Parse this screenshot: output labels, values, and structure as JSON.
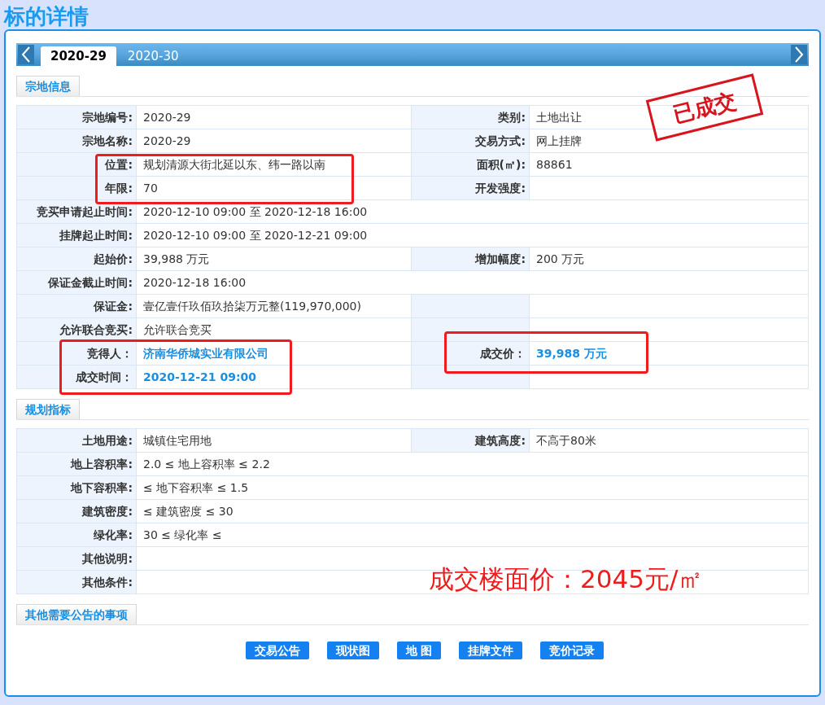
{
  "title": "标的详情",
  "tabs": [
    {
      "label": "2020-29",
      "selected": true
    },
    {
      "label": "2020-30",
      "selected": false
    }
  ],
  "stamp": "已成交",
  "annotation": "成交楼面价：2045元/㎡",
  "sections": [
    {
      "title": "宗地信息",
      "rows": [
        {
          "kind": "pair",
          "label": "宗地编号:",
          "value": "2020-29",
          "label2": "类别:",
          "value2": "土地出让"
        },
        {
          "kind": "pair",
          "label": "宗地名称:",
          "value": "2020-29",
          "label2": "交易方式:",
          "value2": "网上挂牌"
        },
        {
          "kind": "pair",
          "label": "位置:",
          "value": "规划清源大街北延以东、纬一路以南",
          "label2": "面积(㎡):",
          "value2": "88861"
        },
        {
          "kind": "pair",
          "label": "年限:",
          "value": "70",
          "label2": "开发强度:"
        },
        {
          "kind": "wide",
          "label": "竞买申请起止时间:",
          "value": "2020-12-10 09:00 至 2020-12-18 16:00"
        },
        {
          "kind": "wide",
          "label": "挂牌起止时间:",
          "value": "2020-12-10 09:00 至 2020-12-21 09:00"
        },
        {
          "kind": "pair",
          "label": "起始价:",
          "value": "39,988 万元",
          "label2": "增加幅度:",
          "value2": "200 万元"
        },
        {
          "kind": "wide",
          "label": "保证金截止时间:",
          "value": "2020-12-18 16:00"
        },
        {
          "kind": "pair",
          "label": "保证金:",
          "value": "壹亿壹仟玖佰玖拾柒万元整(119,970,000)"
        },
        {
          "kind": "pair",
          "label": "允许联合竞买:",
          "value": "允许联合竞买"
        },
        {
          "kind": "result",
          "label": "竞得人：",
          "value": "济南华侨城实业有限公司",
          "label2": "成交价：",
          "value2": "39,988 万元"
        },
        {
          "kind": "result",
          "label": "成交时间：",
          "value": "2020-12-21 09:00"
        }
      ]
    },
    {
      "title": "规划指标",
      "rows": [
        {
          "kind": "pair",
          "label": "土地用途:",
          "value": "城镇住宅用地",
          "label2": "建筑高度:",
          "value2": "不高于80米"
        },
        {
          "kind": "wide",
          "label": "地上容积率:",
          "value": "2.0 ≤ 地上容积率 ≤ 2.2"
        },
        {
          "kind": "wide",
          "label": "地下容积率:",
          "value": "≤ 地下容积率 ≤ 1.5"
        },
        {
          "kind": "wide",
          "label": "建筑密度:",
          "value": "≤ 建筑密度 ≤ 30"
        },
        {
          "kind": "wide",
          "label": "绿化率:",
          "value": "30 ≤ 绿化率 ≤"
        },
        {
          "kind": "wide",
          "label": "其他说明:"
        },
        {
          "kind": "wide",
          "label": "其他条件:"
        }
      ]
    },
    {
      "title": "其他需要公告的事项"
    }
  ],
  "buttons": [
    "交易公告",
    "现状图",
    "地 图",
    "挂牌文件",
    "竞价记录"
  ]
}
